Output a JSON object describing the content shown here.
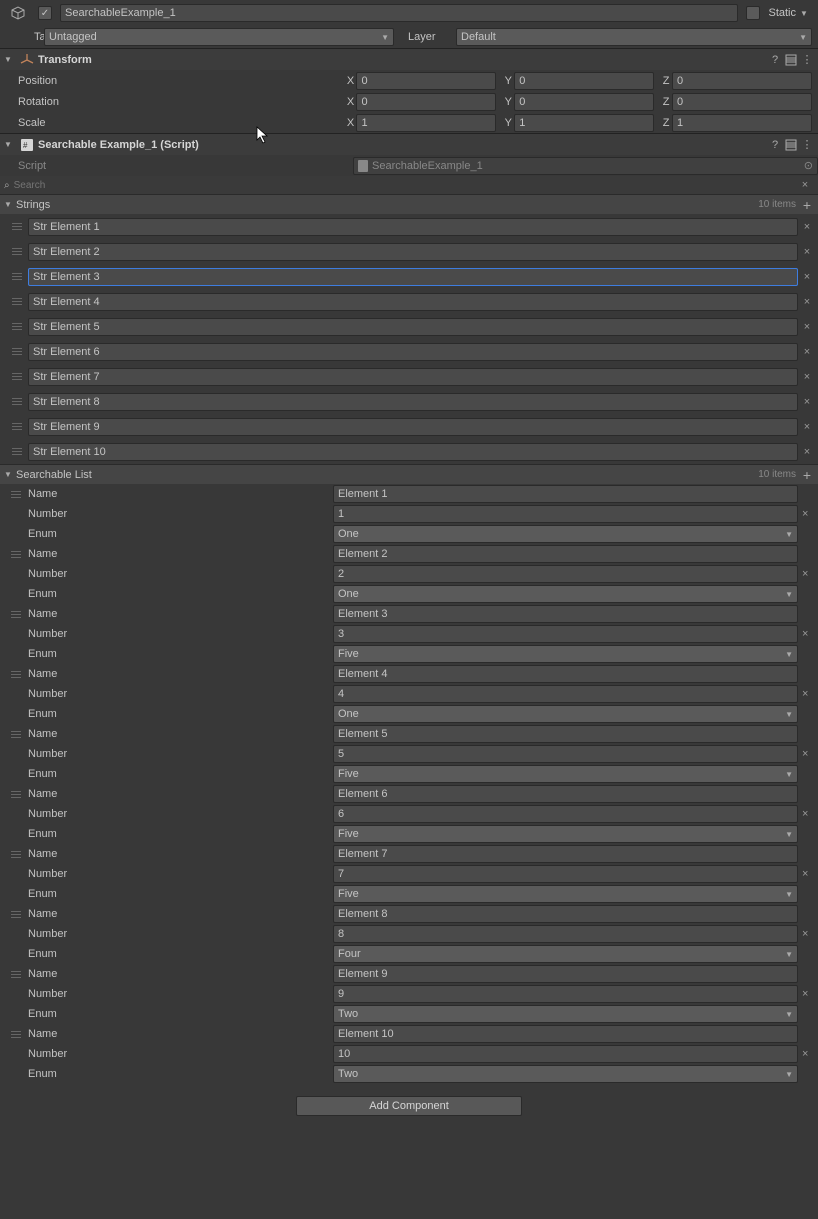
{
  "header": {
    "object_name": "SearchableExample_1",
    "enabled": true,
    "static_label": "Static",
    "static_checked": false,
    "tag_label": "Tag",
    "tag_value": "Untagged",
    "layer_label": "Layer",
    "layer_value": "Default"
  },
  "transform": {
    "title": "Transform",
    "rows": [
      {
        "label": "Position",
        "x": "0",
        "y": "0",
        "z": "0"
      },
      {
        "label": "Rotation",
        "x": "0",
        "y": "0",
        "z": "0"
      },
      {
        "label": "Scale",
        "x": "1",
        "y": "1",
        "z": "1"
      }
    ]
  },
  "script_comp": {
    "title": "Searchable Example_1 (Script)",
    "field_label": "Script",
    "script_ref": "SearchableExample_1",
    "search_placeholder": "Search"
  },
  "strings": {
    "title": "Strings",
    "count_label": "10 items",
    "selected_index": 2,
    "items": [
      "Str Element 1",
      "Str Element 2",
      "Str Element 3",
      "Str Element 4",
      "Str Element 5",
      "Str Element 6",
      "Str Element 7",
      "Str Element 8",
      "Str Element 9",
      "Str Element 10"
    ]
  },
  "searchable_list": {
    "title": "Searchable List",
    "count_label": "10 items",
    "labels": {
      "name": "Name",
      "number": "Number",
      "enum": "Enum"
    },
    "items": [
      {
        "name": "Element 1",
        "number": "1",
        "enum": "One"
      },
      {
        "name": "Element 2",
        "number": "2",
        "enum": "One"
      },
      {
        "name": "Element 3",
        "number": "3",
        "enum": "Five"
      },
      {
        "name": "Element 4",
        "number": "4",
        "enum": "One"
      },
      {
        "name": "Element 5",
        "number": "5",
        "enum": "Five"
      },
      {
        "name": "Element 6",
        "number": "6",
        "enum": "Five"
      },
      {
        "name": "Element 7",
        "number": "7",
        "enum": "Five"
      },
      {
        "name": "Element 8",
        "number": "8",
        "enum": "Four"
      },
      {
        "name": "Element 9",
        "number": "9",
        "enum": "Two"
      },
      {
        "name": "Element 10",
        "number": "10",
        "enum": "Two"
      }
    ]
  },
  "footer": {
    "add_component": "Add Component"
  },
  "colors": {
    "selection": "#3e7de0"
  }
}
